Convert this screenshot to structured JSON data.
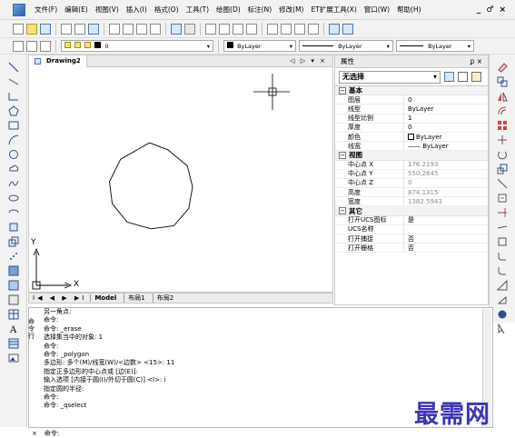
{
  "menu": [
    "文件(F)",
    "编辑(E)",
    "视图(V)",
    "插入(I)",
    "格式(O)",
    "工具(T)",
    "绘图(D)",
    "标注(N)",
    "修改(M)",
    "ET扩展工具(X)",
    "窗口(W)",
    "帮助(H)"
  ],
  "window_controls": [
    "_",
    "♂",
    "×"
  ],
  "toolbar2": {
    "layer_value": "0",
    "color_value": "ByLayer",
    "linetype_value": "ByLayer",
    "lineweight_value": "ByLayer"
  },
  "document": {
    "tab_label": "Drawing2",
    "tab_controls": "◁ ▷ ▾ ×",
    "ucs_x": "X",
    "ucs_y": "Y"
  },
  "layout_tabs": {
    "nav": "I◀ ◀ ▶ ▶I",
    "tabs": [
      "Model",
      "布局1",
      "布局2"
    ]
  },
  "properties": {
    "title": "属性",
    "title_controls": "ꝑ ×",
    "selection": "无选择",
    "groups": [
      {
        "name": "基本",
        "rows": [
          {
            "key": "图层",
            "value": "0",
            "dim": false
          },
          {
            "key": "线型",
            "value": "ByLayer",
            "dim": false
          },
          {
            "key": "线型比例",
            "value": "1",
            "dim": false
          },
          {
            "key": "厚度",
            "value": "0",
            "dim": false
          },
          {
            "key": "颜色",
            "value": "ByLayer",
            "dim": false
          },
          {
            "key": "线宽",
            "value": "—— ByLayer",
            "dim": false
          }
        ]
      },
      {
        "name": "视图",
        "rows": [
          {
            "key": "中心点 X",
            "value": "176.2193",
            "dim": true
          },
          {
            "key": "中心点 Y",
            "value": "550.2645",
            "dim": true
          },
          {
            "key": "中心点 Z",
            "value": "0",
            "dim": true
          },
          {
            "key": "高度",
            "value": "874.1315",
            "dim": true
          },
          {
            "key": "宽度",
            "value": "1382.5943",
            "dim": true
          }
        ]
      },
      {
        "name": "其它",
        "rows": [
          {
            "key": "打开UCS图标",
            "value": "是",
            "dim": false
          },
          {
            "key": "UCS名称",
            "value": "",
            "dim": false
          },
          {
            "key": "打开捕捉",
            "value": "否",
            "dim": false
          },
          {
            "key": "打开栅格",
            "value": "否",
            "dim": false
          }
        ]
      }
    ]
  },
  "command": {
    "side_label": "命令行",
    "lines": [
      "另一角点:",
      "命令:",
      "命令: _erase",
      "选择集当中的对象: 1",
      "命令:",
      "命令: _polygon",
      "多边形:  多个(M)/线宽(W)/<边数> <15>: 11",
      "指定正多边形的中心点或 [边(E)]:",
      "输入选项 [内接于圆(I)/外切于圆(C)] <I>: i",
      "指定圆的半径:",
      "命令:",
      "命令: _qselect"
    ],
    "prompt": "命令:",
    "close": "×"
  },
  "watermark": "最需网"
}
